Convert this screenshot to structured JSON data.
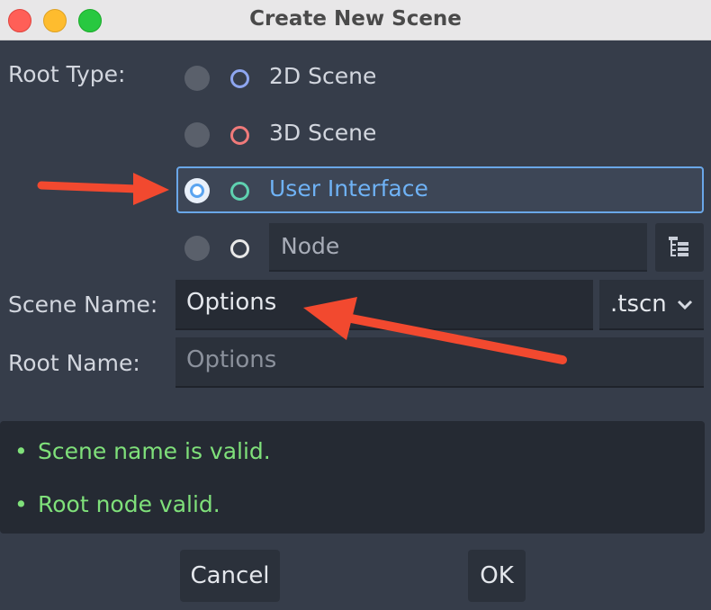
{
  "window": {
    "title": "Create New Scene"
  },
  "root_type": {
    "label": "Root Type:",
    "options": [
      {
        "label": "2D Scene",
        "icon": "circle-outline-icon",
        "icon_color": "#8ea6f0",
        "selected": false
      },
      {
        "label": "3D Scene",
        "icon": "circle-outline-icon",
        "icon_color": "#f07a7a",
        "selected": false
      },
      {
        "label": "User Interface",
        "icon": "circle-outline-icon",
        "icon_color": "#5fd1b0",
        "selected": true
      },
      {
        "label": "Node",
        "icon": "circle-outline-icon",
        "icon_color": "#e8e8e8",
        "selected": false
      }
    ],
    "node_picker_icon": "tree-icon"
  },
  "scene_name": {
    "label": "Scene Name:",
    "value": "Options",
    "extension": ".tscn"
  },
  "root_name": {
    "label": "Root Name:",
    "placeholder": "Options"
  },
  "status": {
    "bullet": "•",
    "messages": [
      "Scene name is valid.",
      "Root node valid."
    ],
    "color": "#7fe07a"
  },
  "buttons": {
    "cancel": "Cancel",
    "ok": "OK"
  },
  "colors": {
    "accent": "#6aa7e8",
    "annotation_arrow": "#f2492f"
  }
}
